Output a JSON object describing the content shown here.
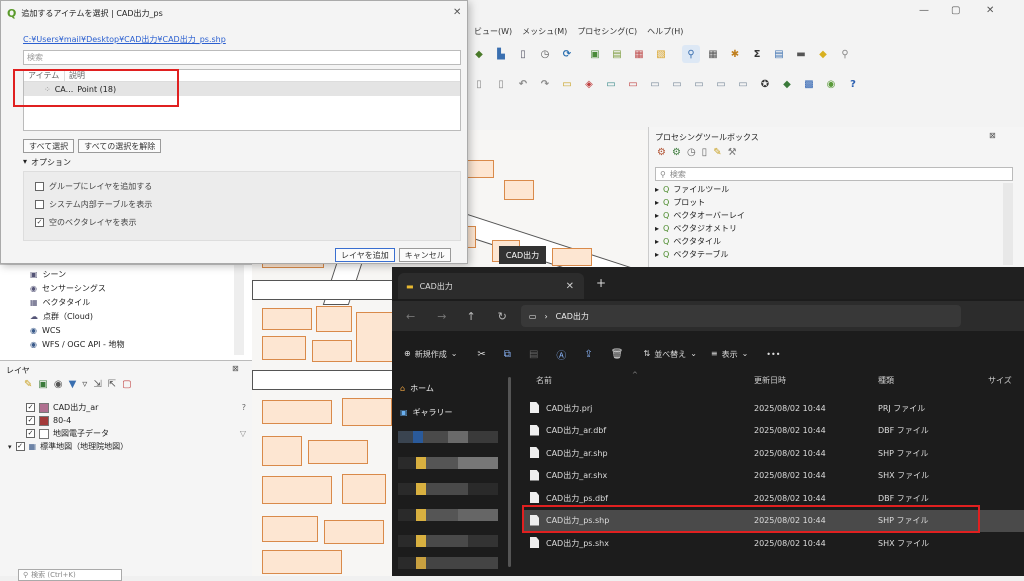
{
  "qgis": {
    "menu": [
      "ビュー(W)",
      "メッシュ(M)",
      "プロセシング(C)",
      "ヘルプ(H)"
    ],
    "window_controls": {
      "minimize": "—",
      "restore": "▢",
      "close": "✕"
    }
  },
  "processing": {
    "title": "プロセシングツールボックス",
    "search_placeholder": "検索",
    "items": [
      "ファイルツール",
      "プロット",
      "ベクタオーバーレイ",
      "ベクタジオメトリ",
      "ベクタタイル",
      "ベクタテーブル"
    ]
  },
  "browser": {
    "items": [
      "シーン",
      "センサーシングス",
      "ベクタタイル",
      "点群（Cloud)",
      "WCS",
      "WFS / OGC API - 地物"
    ]
  },
  "layers": {
    "title": "レイヤ",
    "items": [
      {
        "name": "CAD出力_ar",
        "color": "#b07090"
      },
      {
        "name": "80-4",
        "color": "#a33a3a"
      },
      {
        "name": "地図電子データ",
        "color": "#ffffff"
      },
      {
        "name": "標準地図（地理院地図）",
        "color": ""
      }
    ],
    "search_placeholder": "検索 (Ctrl+K)"
  },
  "dialog": {
    "title": "追加するアイテムを選択 | CAD出力_ps",
    "path": "C:¥Users¥mail¥Desktop¥CAD出力¥CAD出力_ps.shp",
    "search_placeholder": "検索",
    "col_item": "アイテム",
    "col_desc": "説明",
    "row_item": "CA...",
    "row_desc": "Point (18)",
    "select_all": "すべて選択",
    "deselect_all": "すべての選択を解除",
    "options_label": "オプション",
    "opt1": "グループにレイヤを追加する",
    "opt2": "システム内部テーブルを表示",
    "opt3": "空のベクタレイヤを表示",
    "add_layers": "レイヤを追加",
    "cancel": "キャンセル"
  },
  "tooltip": "CAD出力",
  "explorer": {
    "tab_title": "CAD出力",
    "address": "CAD出力",
    "new_label": "新規作成",
    "sort_label": "並べ替え",
    "view_label": "表示",
    "more_label": "•••",
    "nav_home": "ホーム",
    "nav_gallery": "ギャラリー",
    "col_name": "名前",
    "col_date": "更新日時",
    "col_type": "種類",
    "col_size": "サイズ",
    "files": [
      {
        "name": "CAD出力.prj",
        "date": "2025/08/02 10:44",
        "type": "PRJ ファイル"
      },
      {
        "name": "CAD出力_ar.dbf",
        "date": "2025/08/02 10:44",
        "type": "DBF ファイル"
      },
      {
        "name": "CAD出力_ar.shp",
        "date": "2025/08/02 10:44",
        "type": "SHP ファイル"
      },
      {
        "name": "CAD出力_ar.shx",
        "date": "2025/08/02 10:44",
        "type": "SHX ファイル"
      },
      {
        "name": "CAD出力_ps.dbf",
        "date": "2025/08/02 10:44",
        "type": "DBF ファイル"
      },
      {
        "name": "CAD出力_ps.shp",
        "date": "2025/08/02 10:44",
        "type": "SHP ファイル"
      },
      {
        "name": "CAD出力_ps.shx",
        "date": "2025/08/02 10:44",
        "type": "SHX ファイル"
      }
    ]
  }
}
